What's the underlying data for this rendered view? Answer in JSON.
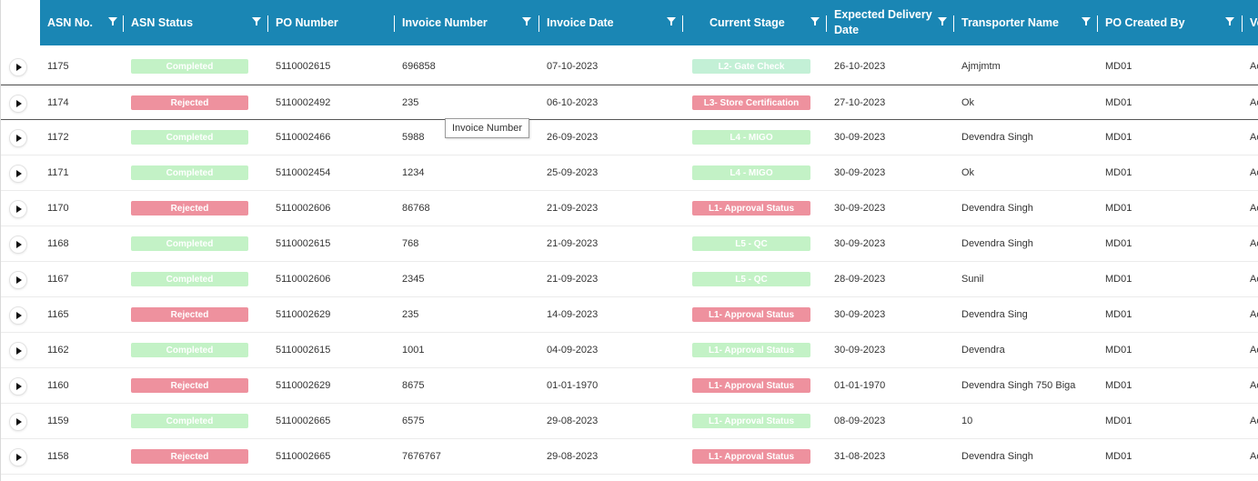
{
  "columns": [
    {
      "label": "ASN No."
    },
    {
      "label": "ASN Status"
    },
    {
      "label": "PO Number"
    },
    {
      "label": "Invoice Number"
    },
    {
      "label": "Invoice Date"
    },
    {
      "label": "Current Stage"
    },
    {
      "label": "Expected Delivery Date"
    },
    {
      "label": "Transporter Name"
    },
    {
      "label": "PO Created By"
    },
    {
      "label": "Ve"
    }
  ],
  "tooltip": "Invoice Number",
  "colors": {
    "header_bg": "#1a86b4",
    "completed": "#c3f2c6",
    "rejected": "#ee919e"
  },
  "rows": [
    {
      "asn": "1175",
      "status": "Completed",
      "po": "5110002615",
      "invoice": "696858",
      "date": "07-10-2023",
      "stage": "L2- Gate Check",
      "delivery": "26-10-2023",
      "transporter": "Ajmjmtm",
      "created_by": "MD01",
      "ve": "Ac"
    },
    {
      "asn": "1174",
      "status": "Rejected",
      "po": "5110002492",
      "invoice": "235",
      "date": "06-10-2023",
      "stage": "L3- Store Certification",
      "delivery": "27-10-2023",
      "transporter": "Ok",
      "created_by": "MD01",
      "ve": "Ac"
    },
    {
      "asn": "1172",
      "status": "Completed",
      "po": "5110002466",
      "invoice": "5988",
      "date": "26-09-2023",
      "stage": "L4 - MIGO",
      "delivery": "30-09-2023",
      "transporter": "Devendra Singh",
      "created_by": "MD01",
      "ve": "Ac"
    },
    {
      "asn": "1171",
      "status": "Completed",
      "po": "5110002454",
      "invoice": "1234",
      "date": "25-09-2023",
      "stage": "L4 - MIGO",
      "delivery": "30-09-2023",
      "transporter": "Ok",
      "created_by": "MD01",
      "ve": "Ac"
    },
    {
      "asn": "1170",
      "status": "Rejected",
      "po": "5110002606",
      "invoice": "86768",
      "date": "21-09-2023",
      "stage": "L1- Approval Status",
      "delivery": "30-09-2023",
      "transporter": "Devendra Singh",
      "created_by": "MD01",
      "ve": "Ac"
    },
    {
      "asn": "1168",
      "status": "Completed",
      "po": "5110002615",
      "invoice": "768",
      "date": "21-09-2023",
      "stage": "L5 - QC",
      "delivery": "30-09-2023",
      "transporter": "Devendra Singh",
      "created_by": "MD01",
      "ve": "Ac"
    },
    {
      "asn": "1167",
      "status": "Completed",
      "po": "5110002606",
      "invoice": "2345",
      "date": "21-09-2023",
      "stage": "L5 - QC",
      "delivery": "28-09-2023",
      "transporter": "Sunil",
      "created_by": "MD01",
      "ve": "Ac"
    },
    {
      "asn": "1165",
      "status": "Rejected",
      "po": "5110002629",
      "invoice": "235",
      "date": "14-09-2023",
      "stage": "L1- Approval Status",
      "delivery": "30-09-2023",
      "transporter": "Devendra Sing",
      "created_by": "MD01",
      "ve": "Ac"
    },
    {
      "asn": "1162",
      "status": "Completed",
      "po": "5110002615",
      "invoice": "1001",
      "date": "04-09-2023",
      "stage": "L1- Approval Status",
      "delivery": "30-09-2023",
      "transporter": "Devendra",
      "created_by": "MD01",
      "ve": "Ac"
    },
    {
      "asn": "1160",
      "status": "Rejected",
      "po": "5110002629",
      "invoice": "8675",
      "date": "01-01-1970",
      "stage": "L1- Approval Status",
      "delivery": "01-01-1970",
      "transporter": "Devendra Singh 750 Biga",
      "created_by": "MD01",
      "ve": "Ac"
    },
    {
      "asn": "1159",
      "status": "Completed",
      "po": "5110002665",
      "invoice": "6575",
      "date": "29-08-2023",
      "stage": "L1- Approval Status",
      "delivery": "08-09-2023",
      "transporter": "10",
      "created_by": "MD01",
      "ve": "Ac"
    },
    {
      "asn": "1158",
      "status": "Rejected",
      "po": "5110002665",
      "invoice": "7676767",
      "date": "29-08-2023",
      "stage": "L1- Approval Status",
      "delivery": "31-08-2023",
      "transporter": "Devendra Singh",
      "created_by": "MD01",
      "ve": "Ac"
    }
  ]
}
